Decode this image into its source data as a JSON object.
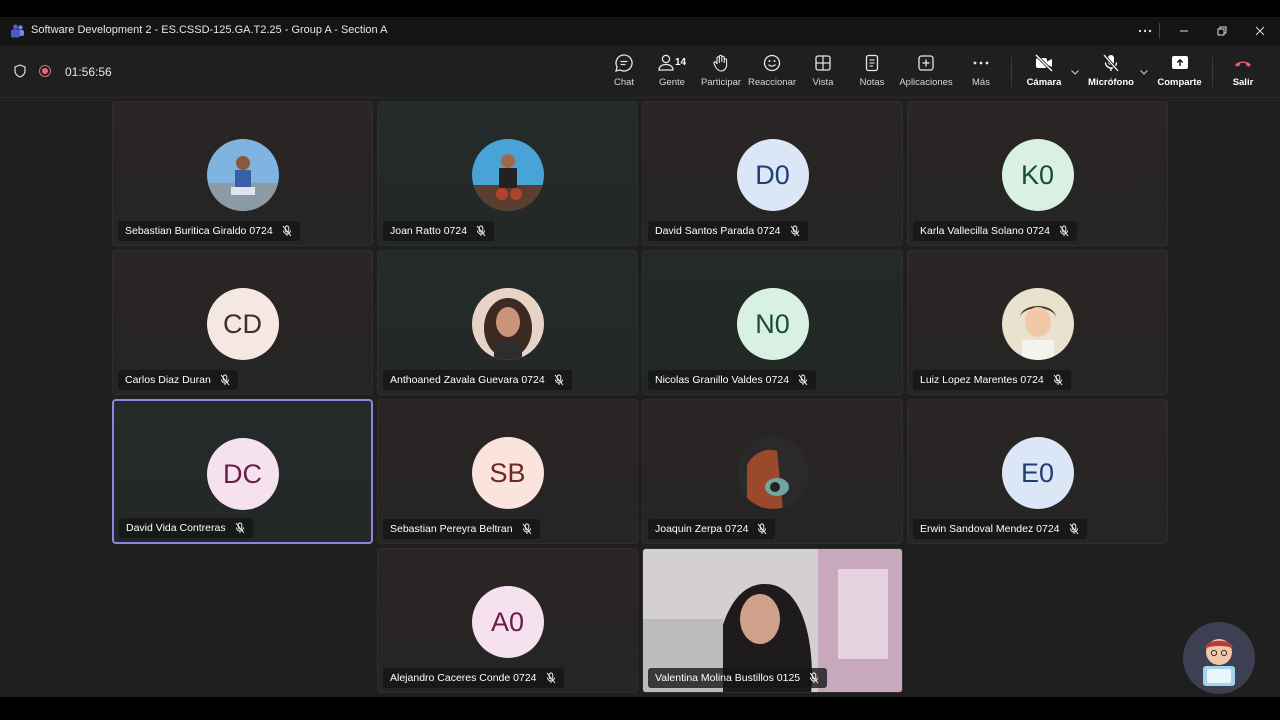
{
  "window": {
    "title": "Software Development 2 - ES.CSSD-125.GA.T2.25 - Group A - Section A",
    "icons": [
      "teams-icon",
      "more-icon",
      "minimize-icon",
      "restore-icon",
      "close-icon"
    ]
  },
  "meeting": {
    "timer": "01:56:56",
    "people_count": "14"
  },
  "toolbar": {
    "chat": "Chat",
    "people": "Gente",
    "raise": "Participar",
    "react": "Reaccionar",
    "view": "Vista",
    "notes": "Notas",
    "apps": "Aplicaciones",
    "more": "Más",
    "camera": "Cámara",
    "mic": "Micrófono",
    "share": "Comparte",
    "leave": "Salir"
  },
  "participants": [
    {
      "name": "Sebastian Buritica Giraldo 0724",
      "avatar": "photo",
      "initials": ""
    },
    {
      "name": "Joan Ratto 0724",
      "avatar": "photo",
      "initials": ""
    },
    {
      "name": "David Santos Parada 0724",
      "avatar": "initials",
      "initials": "D0",
      "bg": "#dbe6f6",
      "fg": "#1f3f73"
    },
    {
      "name": "Karla Vallecilla Solano 0724",
      "avatar": "initials",
      "initials": "K0",
      "bg": "#d9f1e3",
      "fg": "#1b4d36"
    },
    {
      "name": "Carlos Diaz Duran",
      "avatar": "initials",
      "initials": "CD",
      "bg": "#f5e7e1",
      "fg": "#4a2c25"
    },
    {
      "name": "Anthoaned Zavala Guevara 0724",
      "avatar": "photo",
      "initials": ""
    },
    {
      "name": "Nicolas Granillo Valdes 0724",
      "avatar": "initials",
      "initials": "N0",
      "bg": "#d9f1e3",
      "fg": "#1b4d36"
    },
    {
      "name": "Luiz Lopez Marentes 0724",
      "avatar": "photo",
      "initials": ""
    },
    {
      "name": "David Vida Contreras",
      "avatar": "initials",
      "initials": "DC",
      "bg": "#f6e2ee",
      "fg": "#6b1d4a"
    },
    {
      "name": "Sebastian Pereyra Beltran",
      "avatar": "initials",
      "initials": "SB",
      "bg": "#fbe3de",
      "fg": "#6e2a1e"
    },
    {
      "name": "Joaquin Zerpa 0724",
      "avatar": "photo",
      "initials": ""
    },
    {
      "name": "Erwin Sandoval Mendez 0724",
      "avatar": "initials",
      "initials": "E0",
      "bg": "#dbe6f6",
      "fg": "#1f3f73"
    },
    {
      "name": "Alejandro Caceres Conde 0724",
      "avatar": "initials",
      "initials": "A0",
      "bg": "#f6e2ee",
      "fg": "#6b1d4a"
    },
    {
      "name": "Valentina Molina Bustillos 0125",
      "avatar": "video",
      "initials": ""
    }
  ],
  "colors": {
    "accent_active_speaker": "#8b86e0",
    "leave": "#e8616b",
    "recording": "#e06c75"
  }
}
